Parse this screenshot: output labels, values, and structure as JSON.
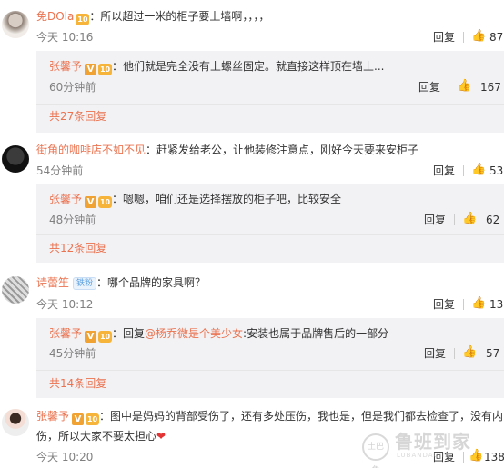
{
  "reply_label": "回复",
  "comments": [
    {
      "user": "免DOla",
      "text": "：所以超过一米的柜子要上墙啊，，，，",
      "time": "今天 10:16",
      "likes": "87",
      "sub": {
        "user": "张馨予",
        "text": "：他们就是完全没有上螺丝固定。就直接这样顶在墙上...",
        "time": "60分钟前",
        "likes": "167",
        "more": "共27条回复"
      }
    },
    {
      "user": "街角的咖啡店不如不见",
      "text": "：赶紧发给老公，让他装修注意点，刚好今天要来安柜子",
      "time": "54分钟前",
      "likes": "53",
      "sub": {
        "user": "张馨予",
        "text": "：嗯嗯，咱们还是选择摆放的柜子吧，比较安全",
        "time": "48分钟前",
        "likes": "62",
        "more": "共12条回复"
      }
    },
    {
      "user": "诗蕾笙",
      "fan_badge": "铁粉",
      "text": "：哪个品牌的家具啊？",
      "time": "今天 10:12",
      "likes": "13",
      "sub": {
        "user": "张馨予",
        "text_prefix": "：回复",
        "mention": "@杨乔微是个美少女",
        "text": ":安装也属于品牌售后的一部分",
        "time": "45分钟前",
        "likes": "57",
        "more": "共14条回复"
      }
    },
    {
      "user": "张馨予",
      "text_line1": "：图中是妈妈的背部受伤了，还有多处压伤，我也是，但是我们都去检查了，没有内",
      "text_line2": "伤，所以大家不要太担心",
      "time": "今天 10:20",
      "likes": "138"
    }
  ],
  "badges": {
    "v": "V",
    "level": "10"
  },
  "watermark": {
    "logo": "土巴兔",
    "text": "鲁班到家",
    "sub": "LUBANDAOJIA"
  }
}
